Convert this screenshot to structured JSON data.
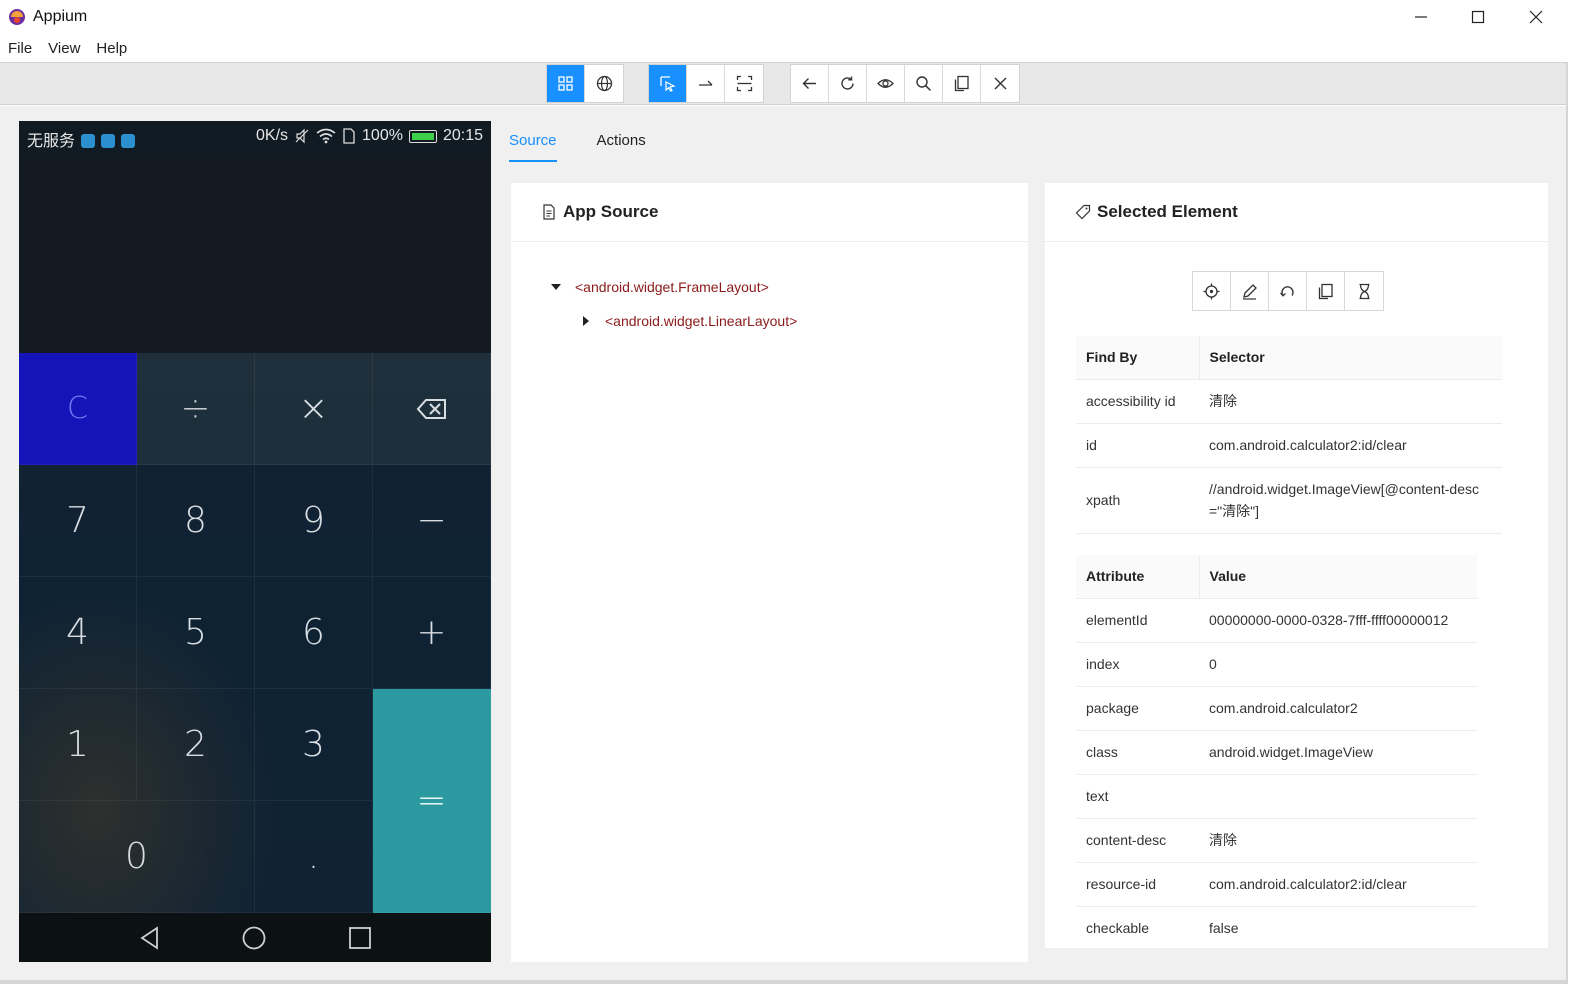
{
  "window": {
    "title": "Appium"
  },
  "menu": [
    "File",
    "View",
    "Help"
  ],
  "toolbar": {
    "groups": [
      [
        "native-app-mode",
        "web-mode"
      ],
      [
        "select-elements",
        "swipe-by-coordinates",
        "tap-by-coordinates"
      ],
      [
        "back",
        "refresh",
        "start-recording",
        "search",
        "copy-xml",
        "quit-session"
      ]
    ]
  },
  "phone": {
    "status_left": "无服务",
    "status_speed": "0K/s",
    "status_battery": "100%",
    "status_time": "20:15",
    "keys": {
      "clear": "C",
      "divide": "÷",
      "multiply": "×",
      "seven": "7",
      "eight": "8",
      "nine": "9",
      "minus": "−",
      "four": "4",
      "five": "5",
      "six": "6",
      "plus": "+",
      "one": "1",
      "two": "2",
      "three": "3",
      "equals": "=",
      "zero": "0",
      "dot": "."
    }
  },
  "tabs": {
    "source": "Source",
    "actions": "Actions"
  },
  "app_source": {
    "title": "App Source",
    "nodes": [
      {
        "label": "<android.widget.FrameLayout>",
        "expanded": true
      },
      {
        "label": "<android.widget.LinearLayout>",
        "expanded": false
      }
    ]
  },
  "selected_element": {
    "title": "Selected Element",
    "selector_headers": {
      "find_by": "Find By",
      "selector": "Selector"
    },
    "selectors": [
      {
        "find_by": "accessibility id",
        "selector": "清除"
      },
      {
        "find_by": "id",
        "selector": "com.android.calculator2:id/clear"
      },
      {
        "find_by": "xpath",
        "selector": "//android.widget.ImageView[@content-desc=\"清除\"]"
      }
    ],
    "attribute_headers": {
      "attribute": "Attribute",
      "value": "Value"
    },
    "attributes": [
      {
        "name": "elementId",
        "value": "00000000-0000-0328-7fff-ffff00000012"
      },
      {
        "name": "index",
        "value": "0"
      },
      {
        "name": "package",
        "value": "com.android.calculator2"
      },
      {
        "name": "class",
        "value": "android.widget.ImageView"
      },
      {
        "name": "text",
        "value": ""
      },
      {
        "name": "content-desc",
        "value": "清除"
      },
      {
        "name": "resource-id",
        "value": "com.android.calculator2:id/clear"
      },
      {
        "name": "checkable",
        "value": "false"
      }
    ]
  },
  "colors": {
    "accent": "#1890ff",
    "tree_tag": "#8b1a1a",
    "clear_key": "#1414b8",
    "equals_key": "#2a9aa0"
  }
}
